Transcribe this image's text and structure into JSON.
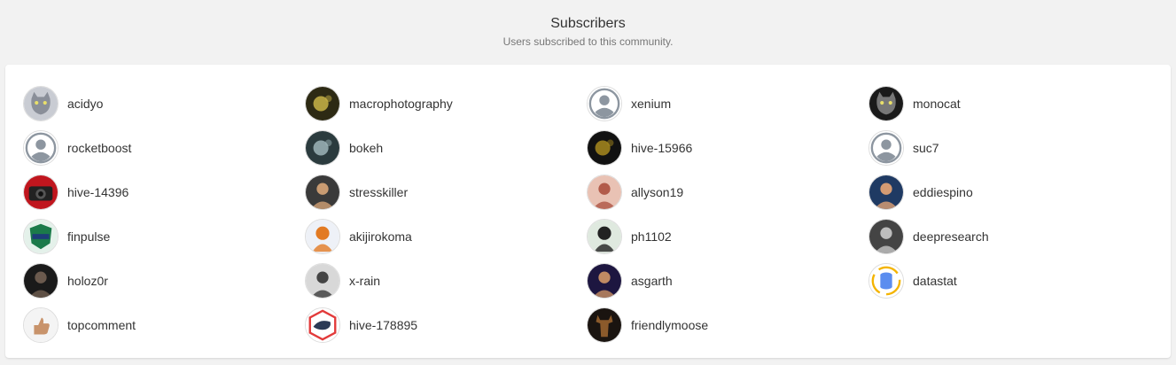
{
  "header": {
    "title": "Subscribers",
    "subtitle": "Users subscribed to this community."
  },
  "subscribers": [
    {
      "name": "acidyo",
      "avatar": "cat-avatar",
      "bg": "#c9ccd3",
      "fg": "#8a8f99"
    },
    {
      "name": "macrophotography",
      "avatar": "photo-avatar",
      "bg": "#2d2a14",
      "fg": "#c9b447"
    },
    {
      "name": "xenium",
      "avatar": "default-user-icon",
      "bg": "#ffffff",
      "fg": "#8d96a0"
    },
    {
      "name": "monocat",
      "avatar": "black-cat-avatar",
      "bg": "#1a1a1a",
      "fg": "#777777"
    },
    {
      "name": "rocketboost",
      "avatar": "default-user-icon",
      "bg": "#ffffff",
      "fg": "#8d96a0"
    },
    {
      "name": "bokeh",
      "avatar": "photo-avatar",
      "bg": "#2b3b3e",
      "fg": "#9db5b8"
    },
    {
      "name": "hive-15966",
      "avatar": "photo-avatar",
      "bg": "#111111",
      "fg": "#a88a1e"
    },
    {
      "name": "suc7",
      "avatar": "default-user-icon",
      "bg": "#ffffff",
      "fg": "#8d96a0"
    },
    {
      "name": "hive-14396",
      "avatar": "camera-avatar",
      "bg": "#c0161e",
      "fg": "#222222"
    },
    {
      "name": "stresskiller",
      "avatar": "person-avatar",
      "bg": "#3a3a3a",
      "fg": "#c99b72"
    },
    {
      "name": "allyson19",
      "avatar": "person-avatar",
      "bg": "#e9c2b4",
      "fg": "#b25b4a"
    },
    {
      "name": "eddiespino",
      "avatar": "person-avatar",
      "bg": "#1f3a63",
      "fg": "#d49b73"
    },
    {
      "name": "finpulse",
      "avatar": "shield-logo-avatar",
      "bg": "#e4f1ea",
      "fg": "#1b7a4a"
    },
    {
      "name": "akijirokoma",
      "avatar": "character-avatar",
      "bg": "#eef1f7",
      "fg": "#e27a23"
    },
    {
      "name": "ph1102",
      "avatar": "character-avatar",
      "bg": "#dfe9df",
      "fg": "#222222"
    },
    {
      "name": "deepresearch",
      "avatar": "person-avatar",
      "bg": "#444444",
      "fg": "#bdbdbd"
    },
    {
      "name": "holoz0r",
      "avatar": "person-avatar",
      "bg": "#1a1a1a",
      "fg": "#6b5a4e"
    },
    {
      "name": "x-rain",
      "avatar": "person-avatar",
      "bg": "#d8d8d8",
      "fg": "#444444"
    },
    {
      "name": "asgarth",
      "avatar": "person-avatar",
      "bg": "#1d1640",
      "fg": "#c08a63"
    },
    {
      "name": "datastat",
      "avatar": "database-logo-avatar",
      "bg": "#ffffff",
      "fg": "#5b8def"
    },
    {
      "name": "topcomment",
      "avatar": "thumbs-up-avatar",
      "bg": "#f4f4f4",
      "fg": "#c8936b"
    },
    {
      "name": "hive-178895",
      "avatar": "orca-logo-avatar",
      "bg": "#ffffff",
      "fg": "#e23a3a"
    },
    {
      "name": "friendlymoose",
      "avatar": "moose-avatar",
      "bg": "#1a1410",
      "fg": "#8b5a2b"
    }
  ]
}
